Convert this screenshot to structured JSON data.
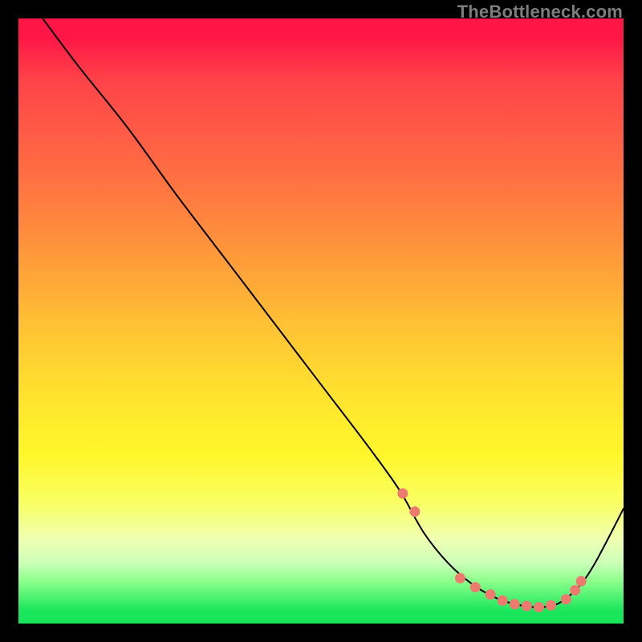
{
  "watermark": "TheBottleneck.com",
  "chart_data": {
    "type": "line",
    "title": "",
    "xlabel": "",
    "ylabel": "",
    "xlim": [
      0,
      100
    ],
    "ylim": [
      0,
      100
    ],
    "series": [
      {
        "name": "bottleneck-curve",
        "x": [
          4,
          10,
          18,
          26,
          34,
          42,
          50,
          58,
          63,
          67,
          71,
          75,
          79,
          83,
          86,
          89,
          92,
          95,
          100
        ],
        "y": [
          100,
          92,
          82,
          71,
          60.5,
          50,
          39.5,
          29,
          22,
          15,
          10,
          6.5,
          4.2,
          3,
          2.7,
          3.2,
          5.5,
          9.5,
          19
        ],
        "stroke": "#000000",
        "stroke_width": 2
      }
    ],
    "markers": {
      "name": "highlight-dots",
      "color": "#ee7a6f",
      "radius": 6.5,
      "points": [
        {
          "x": 63.5,
          "y": 21.5
        },
        {
          "x": 65.5,
          "y": 18.5
        },
        {
          "x": 73.0,
          "y": 7.5
        },
        {
          "x": 75.5,
          "y": 6.0
        },
        {
          "x": 78.0,
          "y": 4.8
        },
        {
          "x": 80.0,
          "y": 3.8
        },
        {
          "x": 82.0,
          "y": 3.2
        },
        {
          "x": 84.0,
          "y": 2.9
        },
        {
          "x": 86.0,
          "y": 2.7
        },
        {
          "x": 88.0,
          "y": 3.0
        },
        {
          "x": 90.5,
          "y": 4.0
        },
        {
          "x": 92.0,
          "y": 5.5
        },
        {
          "x": 93.0,
          "y": 7.0
        }
      ]
    },
    "gradient_stops": [
      {
        "pos": 0.0,
        "color": "#ff1647"
      },
      {
        "pos": 0.5,
        "color": "#ffbf34"
      },
      {
        "pos": 0.8,
        "color": "#f9ff63"
      },
      {
        "pos": 1.0,
        "color": "#19e55b"
      }
    ]
  }
}
